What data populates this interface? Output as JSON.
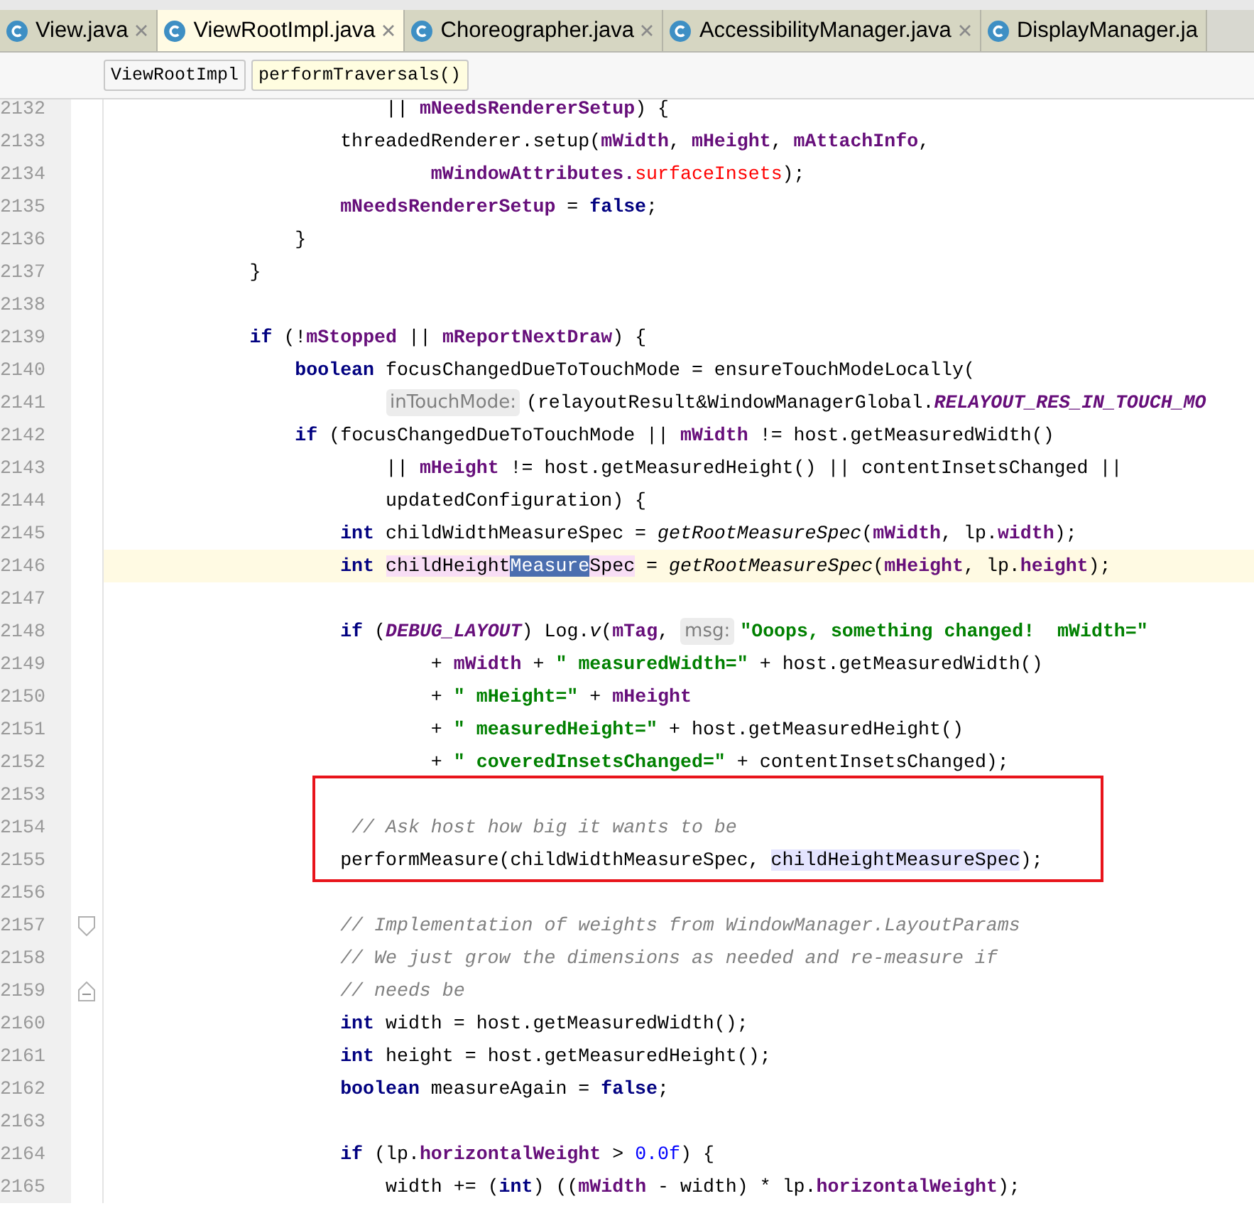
{
  "tabs": [
    {
      "label": "View.java",
      "selected": false,
      "closable": true
    },
    {
      "label": "ViewRootImpl.java",
      "selected": true,
      "closable": true
    },
    {
      "label": "Choreographer.java",
      "selected": false,
      "closable": true
    },
    {
      "label": "AccessibilityManager.java",
      "selected": false,
      "closable": true
    },
    {
      "label": "DisplayManager.ja",
      "selected": false,
      "closable": false
    }
  ],
  "breadcrumbs": [
    {
      "label": "ViewRootImpl",
      "selected": false
    },
    {
      "label": "performTraversals()",
      "selected": true
    }
  ],
  "lines": [
    {
      "number": "2132",
      "tokens": [
        {
          "kind": "plain",
          "text": "                        || "
        },
        {
          "kind": "field",
          "text": "mNeedsRendererSetup"
        },
        {
          "kind": "plain",
          "text": ") {"
        }
      ]
    },
    {
      "number": "2133",
      "tokens": [
        {
          "kind": "plain",
          "text": "                    threadedRenderer.setup("
        },
        {
          "kind": "field",
          "text": "mWidth"
        },
        {
          "kind": "plain",
          "text": ", "
        },
        {
          "kind": "field",
          "text": "mHeight"
        },
        {
          "kind": "plain",
          "text": ", "
        },
        {
          "kind": "field",
          "text": "mAttachInfo"
        },
        {
          "kind": "plain",
          "text": ","
        }
      ]
    },
    {
      "number": "2134",
      "tokens": [
        {
          "kind": "field",
          "text": "                            mWindowAttributes."
        },
        {
          "kind": "error",
          "text": "surfaceInsets"
        },
        {
          "kind": "plain",
          "text": ");"
        }
      ]
    },
    {
      "number": "2135",
      "tokens": [
        {
          "kind": "field",
          "text": "                    mNeedsRendererSetup"
        },
        {
          "kind": "plain",
          "text": " = "
        },
        {
          "kind": "keyword",
          "text": "false"
        },
        {
          "kind": "plain",
          "text": ";"
        }
      ]
    },
    {
      "number": "2136",
      "tokens": [
        {
          "kind": "plain",
          "text": "                }"
        }
      ]
    },
    {
      "number": "2137",
      "tokens": [
        {
          "kind": "plain",
          "text": "            }"
        }
      ]
    },
    {
      "number": "2138"
    },
    {
      "number": "2139",
      "tokens": [
        {
          "kind": "keyword",
          "text": "            if"
        },
        {
          "kind": "plain",
          "text": " (!"
        },
        {
          "kind": "field",
          "text": "mStopped"
        },
        {
          "kind": "plain",
          "text": " || "
        },
        {
          "kind": "field",
          "text": "mReportNextDraw"
        },
        {
          "kind": "plain",
          "text": ") {"
        }
      ]
    },
    {
      "number": "2140",
      "tokens": [
        {
          "kind": "keyword",
          "text": "                boolean"
        },
        {
          "kind": "plain",
          "text": " focusChangedDueToTouchMode = ensureTouchModeLocally("
        }
      ]
    },
    {
      "number": "2141",
      "tokens": [
        {
          "kind": "hint",
          "text": "                        inTouchMode:"
        },
        {
          "kind": "plain",
          "text": "(relayoutResult&WindowManagerGlobal."
        },
        {
          "kind": "constant",
          "text": "RELAYOUT_RES_IN_TOUCH_MO"
        }
      ]
    },
    {
      "number": "2142",
      "tokens": [
        {
          "kind": "keyword",
          "text": "                if"
        },
        {
          "kind": "plain",
          "text": " (focusChangedDueToTouchMode || "
        },
        {
          "kind": "field",
          "text": "mWidth"
        },
        {
          "kind": "plain",
          "text": " != host.getMeasuredWidth()"
        }
      ]
    },
    {
      "number": "2143",
      "tokens": [
        {
          "kind": "plain",
          "text": "                        || "
        },
        {
          "kind": "field",
          "text": "mHeight"
        },
        {
          "kind": "plain",
          "text": " != host.getMeasuredHeight() || contentInsetsChanged ||"
        }
      ]
    },
    {
      "number": "2144",
      "tokens": [
        {
          "kind": "plain",
          "text": "                        updatedConfiguration) {"
        }
      ]
    },
    {
      "number": "2145",
      "tokens": [
        {
          "kind": "keyword",
          "text": "                    int"
        },
        {
          "kind": "plain",
          "text": " childWidthMeasureSpec = "
        },
        {
          "kind": "static",
          "text": "getRootMeasureSpec"
        },
        {
          "kind": "plain",
          "text": "("
        },
        {
          "kind": "field",
          "text": "mWidth"
        },
        {
          "kind": "plain",
          "text": ", lp."
        },
        {
          "kind": "field",
          "text": "width"
        },
        {
          "kind": "plain",
          "text": ");"
        }
      ]
    },
    {
      "number": "2146",
      "current": true,
      "tokens": [
        {
          "kind": "keyword",
          "text": "                    int "
        },
        {
          "kind": "occurrence",
          "text": "childHeight"
        },
        {
          "kind": "selection",
          "text": "Measure"
        },
        {
          "kind": "occurrence",
          "text": "Spec"
        },
        {
          "kind": "plain",
          "text": " = "
        },
        {
          "kind": "static",
          "text": "getRootMeasureSpec"
        },
        {
          "kind": "plain",
          "text": "("
        },
        {
          "kind": "field",
          "text": "mHeight"
        },
        {
          "kind": "plain",
          "text": ", lp."
        },
        {
          "kind": "field",
          "text": "height"
        },
        {
          "kind": "plain",
          "text": ");"
        }
      ]
    },
    {
      "number": "2147"
    },
    {
      "number": "2148",
      "tokens": [
        {
          "kind": "keyword",
          "text": "                    if"
        },
        {
          "kind": "plain",
          "text": " ("
        },
        {
          "kind": "constant",
          "text": "DEBUG_LAYOUT"
        },
        {
          "kind": "plain",
          "text": ") Log."
        },
        {
          "kind": "static",
          "text": "v"
        },
        {
          "kind": "plain",
          "text": "("
        },
        {
          "kind": "field",
          "text": "mTag"
        },
        {
          "kind": "plain",
          "text": ", "
        },
        {
          "kind": "hint",
          "text": "msg:"
        },
        {
          "kind": "string",
          "text": "\"Ooops, something changed!  mWidth=\""
        }
      ]
    },
    {
      "number": "2149",
      "tokens": [
        {
          "kind": "plain",
          "text": "                            + "
        },
        {
          "kind": "field",
          "text": "mWidth"
        },
        {
          "kind": "plain",
          "text": " + "
        },
        {
          "kind": "string",
          "text": "\" measuredWidth=\""
        },
        {
          "kind": "plain",
          "text": " + host.getMeasuredWidth()"
        }
      ]
    },
    {
      "number": "2150",
      "tokens": [
        {
          "kind": "plain",
          "text": "                            + "
        },
        {
          "kind": "string",
          "text": "\" mHeight=\""
        },
        {
          "kind": "plain",
          "text": " + "
        },
        {
          "kind": "field",
          "text": "mHeight"
        }
      ]
    },
    {
      "number": "2151",
      "tokens": [
        {
          "kind": "plain",
          "text": "                            + "
        },
        {
          "kind": "string",
          "text": "\" measuredHeight=\""
        },
        {
          "kind": "plain",
          "text": " + host.getMeasuredHeight()"
        }
      ]
    },
    {
      "number": "2152",
      "tokens": [
        {
          "kind": "plain",
          "text": "                            + "
        },
        {
          "kind": "string",
          "text": "\" coveredInsetsChanged=\""
        },
        {
          "kind": "plain",
          "text": " + contentInsetsChanged);"
        }
      ]
    },
    {
      "number": "2153",
      "boxed": true
    },
    {
      "number": "2154",
      "boxed": true,
      "tokens": [
        {
          "kind": "comment",
          "text": "                     // Ask host how big it wants to be"
        }
      ]
    },
    {
      "number": "2155",
      "boxed": true,
      "tokens": [
        {
          "kind": "plain",
          "text": "                    performMeasure(childWidthMeasureSpec, "
        },
        {
          "kind": "usage",
          "text": "childHeightMeasureSpec"
        },
        {
          "kind": "plain",
          "text": ");"
        }
      ]
    },
    {
      "number": "2156"
    },
    {
      "number": "2157",
      "fold_start": true,
      "tokens": [
        {
          "kind": "comment",
          "text": "                    // Implementation of weights from WindowManager.LayoutParams"
        }
      ]
    },
    {
      "number": "2158",
      "tokens": [
        {
          "kind": "comment",
          "text": "                    // We just grow the dimensions as needed and re-measure if"
        }
      ]
    },
    {
      "number": "2159",
      "fold_end": true,
      "tokens": [
        {
          "kind": "comment",
          "text": "                    // needs be"
        }
      ]
    },
    {
      "number": "2160",
      "tokens": [
        {
          "kind": "keyword",
          "text": "                    int"
        },
        {
          "kind": "plain",
          "text": " width = host.getMeasuredWidth();"
        }
      ]
    },
    {
      "number": "2161",
      "tokens": [
        {
          "kind": "keyword",
          "text": "                    int"
        },
        {
          "kind": "plain",
          "text": " height = host.getMeasuredHeight();"
        }
      ]
    },
    {
      "number": "2162",
      "tokens": [
        {
          "kind": "keyword",
          "text": "                    boolean"
        },
        {
          "kind": "plain",
          "text": " measureAgain = "
        },
        {
          "kind": "keyword",
          "text": "false"
        },
        {
          "kind": "plain",
          "text": ";"
        }
      ]
    },
    {
      "number": "2163"
    },
    {
      "number": "2164",
      "tokens": [
        {
          "kind": "keyword",
          "text": "                    if"
        },
        {
          "kind": "plain",
          "text": " (lp."
        },
        {
          "kind": "field",
          "text": "horizontalWeight"
        },
        {
          "kind": "plain",
          "text": " > "
        },
        {
          "kind": "number",
          "text": "0.0f"
        },
        {
          "kind": "plain",
          "text": ") {"
        }
      ]
    },
    {
      "number": "2165",
      "tokens": [
        {
          "kind": "plain",
          "text": "                        width += ("
        },
        {
          "kind": "keyword",
          "text": "int"
        },
        {
          "kind": "plain",
          "text": ") (("
        },
        {
          "kind": "field",
          "text": "mWidth"
        },
        {
          "kind": "plain",
          "text": " - width) * lp."
        },
        {
          "kind": "field",
          "text": "horizontalWeight"
        },
        {
          "kind": "plain",
          "text": ");"
        }
      ]
    }
  ]
}
